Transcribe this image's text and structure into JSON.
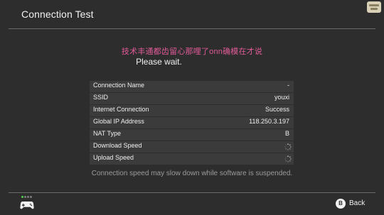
{
  "header": {
    "title": "Connection Test"
  },
  "status": {
    "overlay_text": "技术丰通都齿留心那哩了onn确模在才说",
    "message": "Please wait."
  },
  "results": [
    {
      "label": "Connection Name",
      "value": "-",
      "state": "text"
    },
    {
      "label": "SSID",
      "value": "youxi",
      "state": "text"
    },
    {
      "label": "Internet Connection",
      "value": "Success",
      "state": "text"
    },
    {
      "label": "Global IP Address",
      "value": "118.250.3.197",
      "state": "text"
    },
    {
      "label": "NAT Type",
      "value": "B",
      "state": "text"
    },
    {
      "label": "Download Speed",
      "value": "",
      "state": "loading"
    },
    {
      "label": "Upload Speed",
      "value": "",
      "state": "loading"
    }
  ],
  "note": "Connection speed may slow down while software is suspended.",
  "footer": {
    "back_key": "B",
    "back_label": "Back",
    "controller_icon": "controller-icon",
    "indicator_count": 4,
    "active_indicator": 0
  },
  "colors": {
    "background": "#2d2d2d",
    "row_background": "#3b3b3b",
    "accent_text": "#e05a98",
    "indicator_active": "#4fd44f"
  }
}
